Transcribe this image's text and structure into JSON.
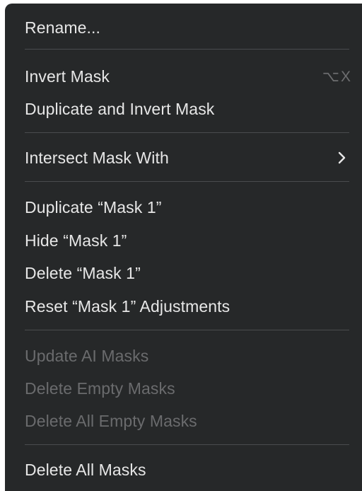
{
  "menu": {
    "items": [
      {
        "label": "Rename..."
      },
      {
        "label": "Invert Mask",
        "shortcut": "⌥X"
      },
      {
        "label": "Duplicate and Invert Mask"
      },
      {
        "label": "Intersect Mask With"
      },
      {
        "label": "Duplicate “Mask 1”"
      },
      {
        "label": "Hide “Mask 1”"
      },
      {
        "label": "Delete “Mask 1”"
      },
      {
        "label": "Reset “Mask 1” Adjustments"
      },
      {
        "label": "Update AI Masks",
        "disabled": true
      },
      {
        "label": "Delete Empty Masks",
        "disabled": true
      },
      {
        "label": "Delete All Empty Masks",
        "disabled": true
      },
      {
        "label": "Delete All Masks"
      }
    ]
  },
  "colors": {
    "background": "#262829",
    "text": "#e7e7e7",
    "disabled_text": "#6a6b6d",
    "separator": "#4a4c4e"
  }
}
